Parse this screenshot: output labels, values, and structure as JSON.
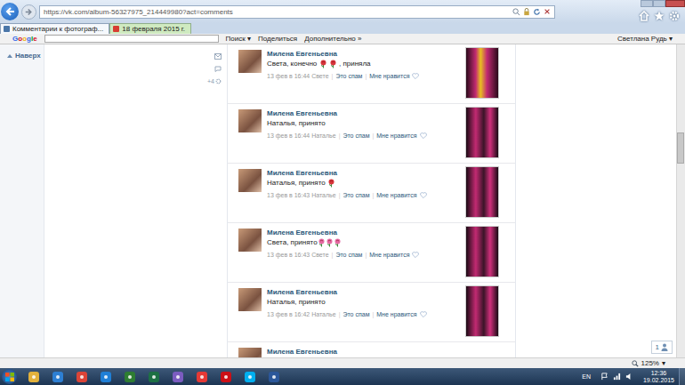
{
  "browser": {
    "address": "https://vk.com/album-56327975_214449980?act=comments",
    "tabs": [
      {
        "label": "Комментарии к фотограф...",
        "selected": true
      },
      {
        "label": "18 февраля 2015 г.",
        "selected": false
      }
    ]
  },
  "google_bar": {
    "logo": "Google",
    "search_button": "Поиск ▾",
    "share": "Поделиться",
    "more": "Дополнительно »",
    "user": "Светлана Рудь ▾"
  },
  "sidebar": {
    "up_link": "Наверх",
    "side_count": "+4"
  },
  "meta_separator": "|",
  "comments": [
    {
      "name": "Милена Евгеньевна",
      "parts": [
        {
          "kind": "text",
          "text": "Света, конечно "
        },
        {
          "kind": "emoji",
          "color": "#d8353a"
        },
        {
          "kind": "text",
          "text": " "
        },
        {
          "kind": "emoji",
          "color": "#d8353a"
        },
        {
          "kind": "text",
          "text": " , приняла"
        }
      ],
      "meta": "13 фев в 16:44 Свете",
      "spam": "Это спам",
      "like": "Мне нравится"
    },
    {
      "name": "Милена Евгеньевна",
      "parts": [
        {
          "kind": "text",
          "text": "Наталья, принято"
        }
      ],
      "meta": "13 фев в 16:44 Наталье",
      "spam": "Это спам",
      "like": "Мне нравится"
    },
    {
      "name": "Милена Евгеньевна",
      "parts": [
        {
          "kind": "text",
          "text": "Наталья, принято "
        },
        {
          "kind": "emoji",
          "color": "#d8353a"
        }
      ],
      "meta": "13 фев в 16:43 Наталье",
      "spam": "Это спам",
      "like": "Мне нравится"
    },
    {
      "name": "Милена Евгеньевна",
      "parts": [
        {
          "kind": "text",
          "text": "Света, принято"
        },
        {
          "kind": "emoji",
          "color": "#e56aa3"
        },
        {
          "kind": "emoji",
          "color": "#e56aa3"
        },
        {
          "kind": "emoji",
          "color": "#e56aa3"
        }
      ],
      "meta": "13 фев в 16:43 Свете",
      "spam": "Это спам",
      "like": "Мне нравится"
    },
    {
      "name": "Милена Евгеньевна",
      "parts": [
        {
          "kind": "text",
          "text": "Наталья, принято"
        }
      ],
      "meta": "13 фев в 16:42 Наталье",
      "spam": "Это спам",
      "like": "Мне нравится"
    }
  ],
  "partial_comment": {
    "name": "Милена Евгеньевна"
  },
  "scrollbar": {
    "level": 0.33
  },
  "viewers_badge": "1",
  "status_bar": {
    "zoom": "125%",
    "zoom_menu": "▾"
  },
  "taskbar": {
    "language": "EN",
    "time": "12:36",
    "date": "19.02.2015",
    "apps": [
      {
        "color": "#e2b13c"
      },
      {
        "color": "#2d7fd3"
      },
      {
        "color": "#db4437"
      },
      {
        "color": "#1f7fd6"
      },
      {
        "color": "#2e7d32"
      },
      {
        "color": "#1d7044"
      },
      {
        "color": "#7b5cc0"
      },
      {
        "color": "#e53935"
      },
      {
        "color": "#cc0f16"
      },
      {
        "color": "#00aff0"
      },
      {
        "color": "#2b579a"
      }
    ]
  }
}
